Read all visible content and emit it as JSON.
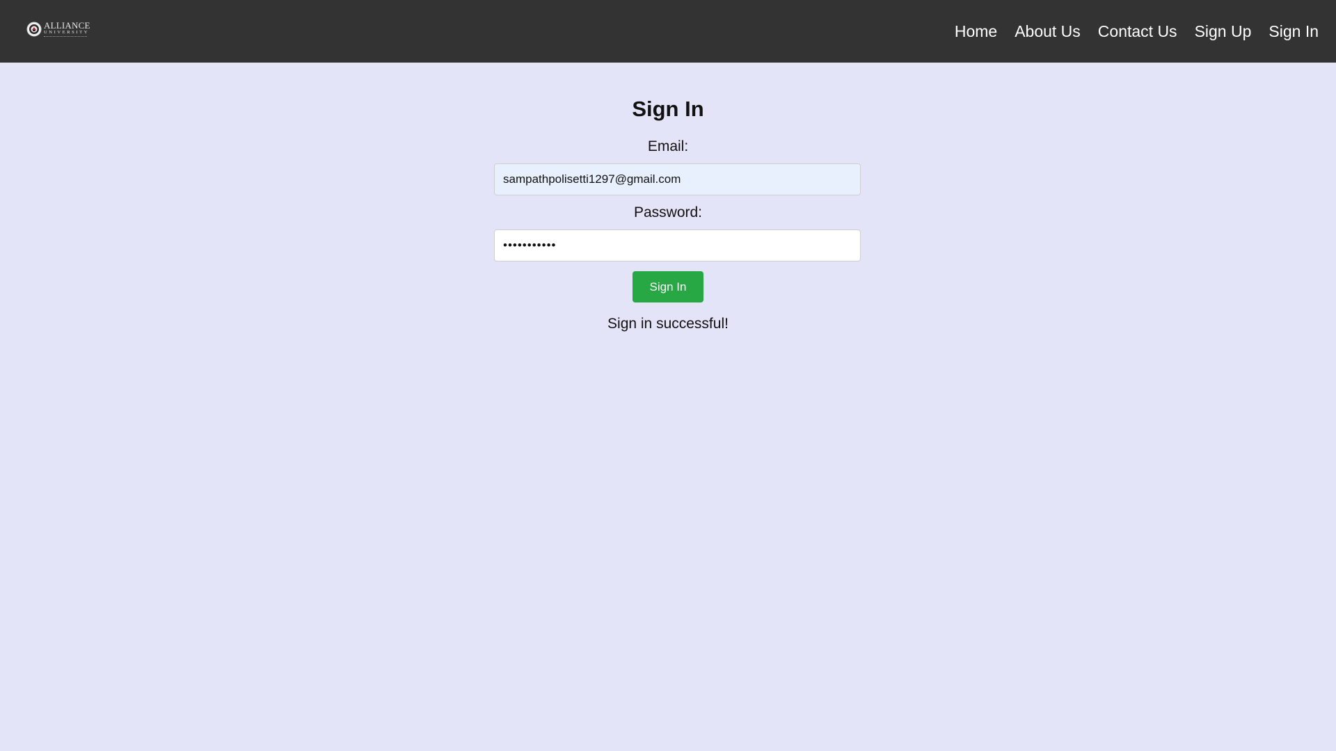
{
  "navbar": {
    "logo": {
      "name": "ALLIANCE",
      "sub": "UNIVERSITY",
      "icon": "university-seal-icon"
    },
    "links": [
      {
        "label": "Home"
      },
      {
        "label": "About Us"
      },
      {
        "label": "Contact Us"
      },
      {
        "label": "Sign Up"
      },
      {
        "label": "Sign In"
      }
    ],
    "background": "#333333"
  },
  "form": {
    "title": "Sign In",
    "email_label": "Email:",
    "email_value": "sampathpolisetti1297@gmail.com",
    "password_label": "Password:",
    "password_value": "sampath1234",
    "submit_label": "Sign In",
    "message": "Sign in successful!"
  },
  "colors": {
    "page_background": "#e3e4f8",
    "button": "#28a745",
    "autofill_field": "#e8f0fe"
  }
}
